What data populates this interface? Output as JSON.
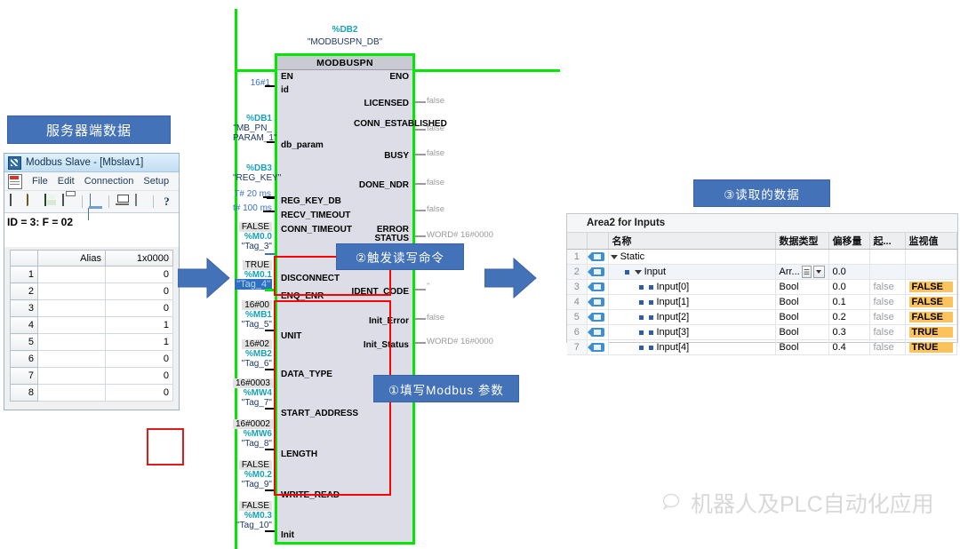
{
  "captions": {
    "server_data": "服务器端数据",
    "step1": "①填写Modbus 参数",
    "step2": "②触发读写命令",
    "step3": "③读取的数据"
  },
  "modbus_slave": {
    "title": "Modbus Slave - [Mbslav1]",
    "app_icon": "modbus-app-icon",
    "menu": [
      "File",
      "Edit",
      "Connection",
      "Setup"
    ],
    "menu_icon": "document-red-icon",
    "toolbar_icons": [
      "new-document-icon",
      "open-folder-icon",
      "save-disk-icon",
      "print-icon",
      "display-panel-icon",
      "connect-icon",
      "print-preview-icon",
      "help-icon"
    ],
    "help_glyph": "?",
    "status": "ID = 3: F = 02",
    "columns": [
      "",
      "Alias",
      "1x0000"
    ],
    "rows": [
      {
        "idx": "1",
        "alias": "",
        "value": "0"
      },
      {
        "idx": "2",
        "alias": "",
        "value": "0"
      },
      {
        "idx": "3",
        "alias": "",
        "value": "0"
      },
      {
        "idx": "4",
        "alias": "",
        "value": "1"
      },
      {
        "idx": "5",
        "alias": "",
        "value": "1"
      },
      {
        "idx": "6",
        "alias": "",
        "value": "0"
      },
      {
        "idx": "7",
        "alias": "",
        "value": "0"
      },
      {
        "idx": "8",
        "alias": "",
        "value": "0"
      }
    ]
  },
  "fb": {
    "db_number": "%DB2",
    "db_name": "\"MODBUSPN_DB\"",
    "block_name": "MODBUSPN",
    "inputs": [
      {
        "pin": "EN",
        "value": "",
        "addr": "",
        "tag": ""
      },
      {
        "pin": "id",
        "value": "16#1",
        "addr": "",
        "tag": ""
      },
      {
        "pin": "db_param",
        "value": "%DB1",
        "addr": "",
        "tag": "\"MB_PN_PARAM_1\""
      },
      {
        "pin": "REG_KEY_DB",
        "value": "%DB3",
        "addr": "",
        "tag": "\"REG_KEY\""
      },
      {
        "pin": "RECV_TIMEOUT",
        "value": "T# 20 ms",
        "addr": "",
        "tag": ""
      },
      {
        "pin": "CONN_TIMEOUT",
        "value": "t# 100 ms",
        "addr": "",
        "tag": ""
      },
      {
        "pin": "DISCONNECT",
        "value": "FALSE",
        "addr": "%M0.0",
        "tag": "\"Tag_3\""
      },
      {
        "pin": "ENQ_ENR",
        "value": "TRUE",
        "addr": "%M0.1",
        "tag": "\"Tag_4\""
      },
      {
        "pin": "UNIT",
        "value": "16#00",
        "addr": "%MB1",
        "tag": "\"Tag_5\""
      },
      {
        "pin": "DATA_TYPE",
        "value": "16#02",
        "addr": "%MB2",
        "tag": "\"Tag_6\""
      },
      {
        "pin": "START_ADDRESS",
        "value": "16#0003",
        "addr": "%MW4",
        "tag": "\"Tag_7\""
      },
      {
        "pin": "LENGTH",
        "value": "16#0002",
        "addr": "%MW6",
        "tag": "\"Tag_8\""
      },
      {
        "pin": "WRITE_READ",
        "value": "FALSE",
        "addr": "%M0.2",
        "tag": "\"Tag_9\""
      },
      {
        "pin": "Init",
        "value": "FALSE",
        "addr": "%M0.3",
        "tag": "\"Tag_10\""
      }
    ],
    "outputs": [
      {
        "pin": "ENO",
        "value": ""
      },
      {
        "pin": "LICENSED",
        "value": "false"
      },
      {
        "pin": "CONN_ESTABLISHED",
        "value": "false"
      },
      {
        "pin": "BUSY",
        "value": "false"
      },
      {
        "pin": "DONE_NDR",
        "value": "false"
      },
      {
        "pin": "ERROR",
        "value": "false"
      },
      {
        "pin": "STATUS",
        "value": "WORD# 16#0000"
      },
      {
        "pin": "IDENT_CODE",
        "value": "''"
      },
      {
        "pin": "Init_Error",
        "value": "false"
      },
      {
        "pin": "Init_Status",
        "value": "WORD# 16#0000"
      }
    ],
    "hidden_output_value": "''"
  },
  "tia_table": {
    "area_title": "Area2 for Inputs",
    "columns": [
      "",
      "",
      "名称",
      "数据类型",
      "偏移量",
      "起...",
      "监视值"
    ],
    "rows": [
      {
        "idx": "1",
        "name": "Static",
        "indent": 0,
        "expand": "caret",
        "datatype": "",
        "offset": "",
        "start": "",
        "monitor": "",
        "mon_hl": false
      },
      {
        "idx": "2",
        "name": "Input",
        "indent": 1,
        "expand": "caret",
        "datatype": "Arr...",
        "offset": "0.0",
        "start": "",
        "monitor": "",
        "mon_hl": false,
        "selected": true,
        "has_dtype_buttons": true
      },
      {
        "idx": "3",
        "name": "Input[0]",
        "indent": 2,
        "expand": "none",
        "datatype": "Bool",
        "offset": "0.0",
        "start": "false",
        "monitor": "FALSE",
        "mon_hl": true
      },
      {
        "idx": "4",
        "name": "Input[1]",
        "indent": 2,
        "expand": "none",
        "datatype": "Bool",
        "offset": "0.1",
        "start": "false",
        "monitor": "FALSE",
        "mon_hl": true
      },
      {
        "idx": "5",
        "name": "Input[2]",
        "indent": 2,
        "expand": "none",
        "datatype": "Bool",
        "offset": "0.2",
        "start": "false",
        "monitor": "FALSE",
        "mon_hl": true
      },
      {
        "idx": "6",
        "name": "Input[3]",
        "indent": 2,
        "expand": "none",
        "datatype": "Bool",
        "offset": "0.3",
        "start": "false",
        "monitor": "TRUE",
        "mon_hl": true
      },
      {
        "idx": "7",
        "name": "Input[4]",
        "indent": 2,
        "expand": "none",
        "datatype": "Bool",
        "offset": "0.4",
        "start": "false",
        "monitor": "TRUE",
        "mon_hl": true
      }
    ]
  },
  "watermark": {
    "icon": "wechat-icon",
    "text": "机器人及PLC自动化应用"
  },
  "colors": {
    "caption_blue": "#4472b8",
    "rail_green": "#00e800",
    "highlight_red": "#ff0000",
    "monitor_orange": "#fcc35c",
    "arrow_blue": "#4472b8",
    "tag_cyan": "#17a2b8"
  }
}
